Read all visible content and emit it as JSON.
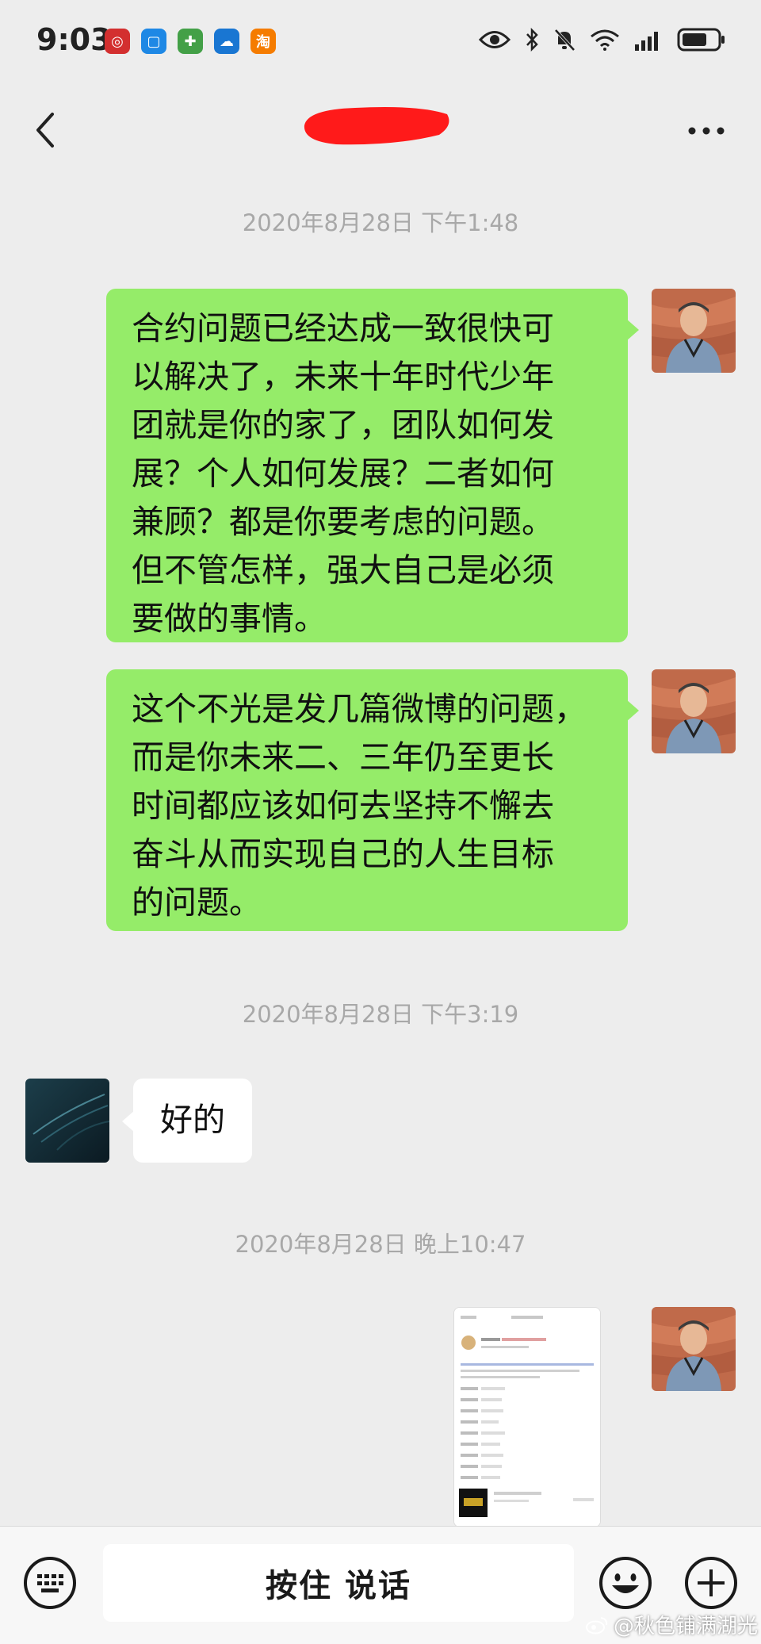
{
  "status_bar": {
    "time": "9:03",
    "app_icons": [
      "bank-app-icon",
      "message-app-icon",
      "health-app-icon",
      "cloud-app-icon",
      "taobao-app-icon"
    ],
    "right_icons": [
      "eye-icon",
      "bluetooth-icon",
      "mute-icon",
      "wifi-icon",
      "signal-icon",
      "battery-icon"
    ]
  },
  "nav": {
    "back_icon": "chevron-left-icon",
    "more_icon": "more-dots-icon"
  },
  "chat": {
    "timestamps": [
      "2020年8月28日 下午1:48",
      "2020年8月28日 下午3:19",
      "2020年8月28日 晚上10:47"
    ],
    "messages": [
      {
        "side": "out",
        "lines": [
          "合约问题已经达成一致很快可",
          "以解决了，未来十年时代少年",
          "团就是你的家了，团队如何发",
          "展？个人如何发展？二者如何",
          "兼顾？都是你要考虑的问题。",
          "但不管怎样，强大自己是必须",
          "要做的事情。"
        ]
      },
      {
        "side": "out",
        "lines": [
          "这个不光是发几篇微博的问题，",
          "而是你未来二、三年仍至更长",
          "时间都应该如何去坚持不懈去",
          "奋斗从而实现自己的人生目标",
          "的问题。"
        ]
      },
      {
        "side": "in",
        "text": "好的"
      },
      {
        "side": "out",
        "type": "image"
      }
    ]
  },
  "input_bar": {
    "voice_label": "按住 说话",
    "keyboard_icon": "keyboard-icon",
    "emoji_icon": "emoji-icon",
    "plus_icon": "plus-icon"
  },
  "watermark": {
    "text": "@秋色铺满湖光"
  },
  "colors": {
    "background": "#ededed",
    "outgoing_bubble": "#95ec69",
    "incoming_bubble": "#ffffff",
    "timestamp": "#a8a8a8",
    "redaction": "#ff1a1a"
  }
}
